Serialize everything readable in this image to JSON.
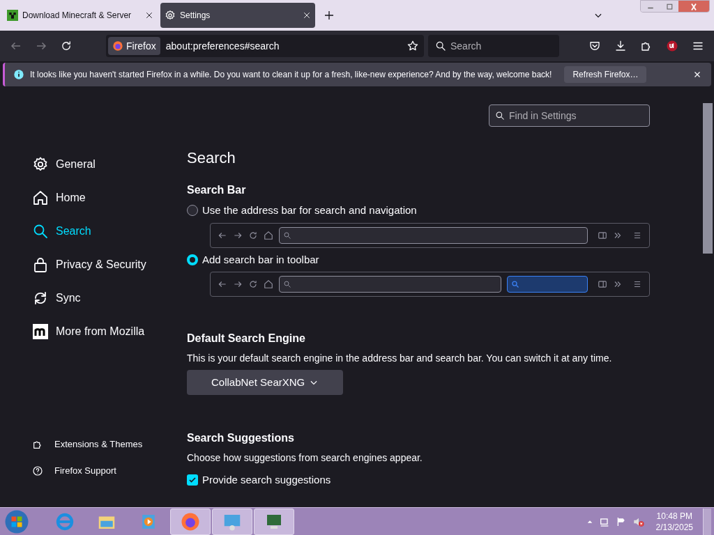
{
  "tabs": [
    {
      "label": "Download Minecraft & Server",
      "kind": "favicon",
      "selected": false
    },
    {
      "label": "Settings",
      "kind": "gear",
      "selected": true
    }
  ],
  "navbar": {
    "identity": "Firefox",
    "url": "about:preferences#search",
    "search_placeholder": "Search"
  },
  "notification": {
    "message": "It looks like you haven't started Firefox in a while. Do you want to clean it up for a fresh, like-new experience? And by the way, welcome back!",
    "button": "Refresh Firefox…"
  },
  "find": {
    "placeholder": "Find in Settings"
  },
  "sidebar": {
    "items": [
      {
        "label": "General",
        "kind": "gear",
        "selected": false
      },
      {
        "label": "Home",
        "kind": "home",
        "selected": false
      },
      {
        "label": "Search",
        "kind": "search",
        "selected": true
      },
      {
        "label": "Privacy & Security",
        "kind": "lock",
        "selected": false
      },
      {
        "label": "Sync",
        "kind": "sync",
        "selected": false
      },
      {
        "label": "More from Mozilla",
        "kind": "mozilla",
        "selected": false
      }
    ],
    "footer_items": [
      {
        "label": "Extensions & Themes",
        "kind": "puzzle"
      },
      {
        "label": "Firefox Support",
        "kind": "help"
      }
    ]
  },
  "page": {
    "title": "Search",
    "search_bar": {
      "heading": "Search Bar",
      "options": [
        {
          "label": "Use the address bar for search and navigation",
          "kind": "address",
          "selected": false
        },
        {
          "label": "Add search bar in toolbar",
          "kind": "toolbar",
          "selected": true
        }
      ]
    },
    "default_engine": {
      "heading": "Default Search Engine",
      "description": "This is your default search engine in the address bar and search bar. You can switch it at any time.",
      "value": "CollabNet SearXNG"
    },
    "suggestions": {
      "heading": "Search Suggestions",
      "description": "Choose how suggestions from search engines appear.",
      "checkbox": {
        "label": "Provide search suggestions",
        "checked": true
      }
    }
  },
  "taskbar": {
    "time": "10:48 PM",
    "date": "2/13/2025"
  }
}
